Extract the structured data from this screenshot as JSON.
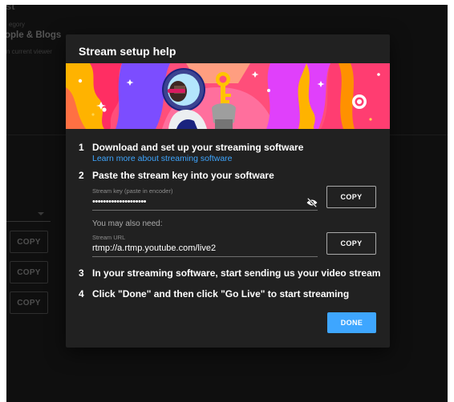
{
  "background": {
    "title_fragment": "st",
    "category_label": "egory",
    "category_value": "ople & Blogs",
    "subtext": "n current viewer",
    "copy_buttons": [
      "COPY",
      "COPY",
      "COPY"
    ]
  },
  "dialog": {
    "title": "Stream setup help",
    "steps": [
      {
        "num": "1",
        "text": "Download and set up your streaming software"
      },
      {
        "num": "2",
        "text": "Paste the stream key into your software"
      },
      {
        "num": "3",
        "text": "In your streaming software, start sending us your video stream"
      },
      {
        "num": "4",
        "text": "Click \"Done\" and then click \"Go Live\" to start streaming"
      }
    ],
    "learn_more_link": "Learn more about streaming software",
    "stream_key": {
      "label": "Stream key (paste in encoder)",
      "value": "••••••••••••••••••••",
      "copy_label": "COPY"
    },
    "also_need": "You may also need:",
    "stream_url": {
      "label": "Stream URL",
      "value": "rtmp://a.rtmp.youtube.com/live2",
      "copy_label": "COPY"
    },
    "done_label": "DONE"
  },
  "colors": {
    "accent": "#3ea6ff",
    "dialog_bg": "#212121",
    "page_bg": "#0f0f0f"
  },
  "icons": {
    "visibility_toggle": "eye-off-icon",
    "banner": "astronaut-holding-key-illustration"
  }
}
